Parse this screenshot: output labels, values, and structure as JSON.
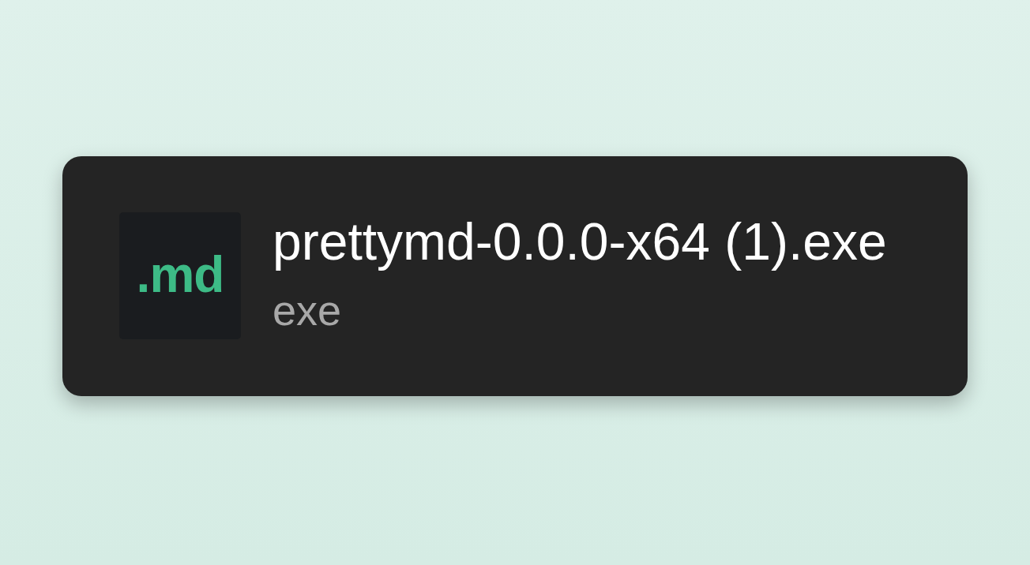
{
  "download": {
    "icon_label": ".md",
    "file_name": "prettymd-0.0.0-x64 (1).exe",
    "file_type": "exe"
  }
}
